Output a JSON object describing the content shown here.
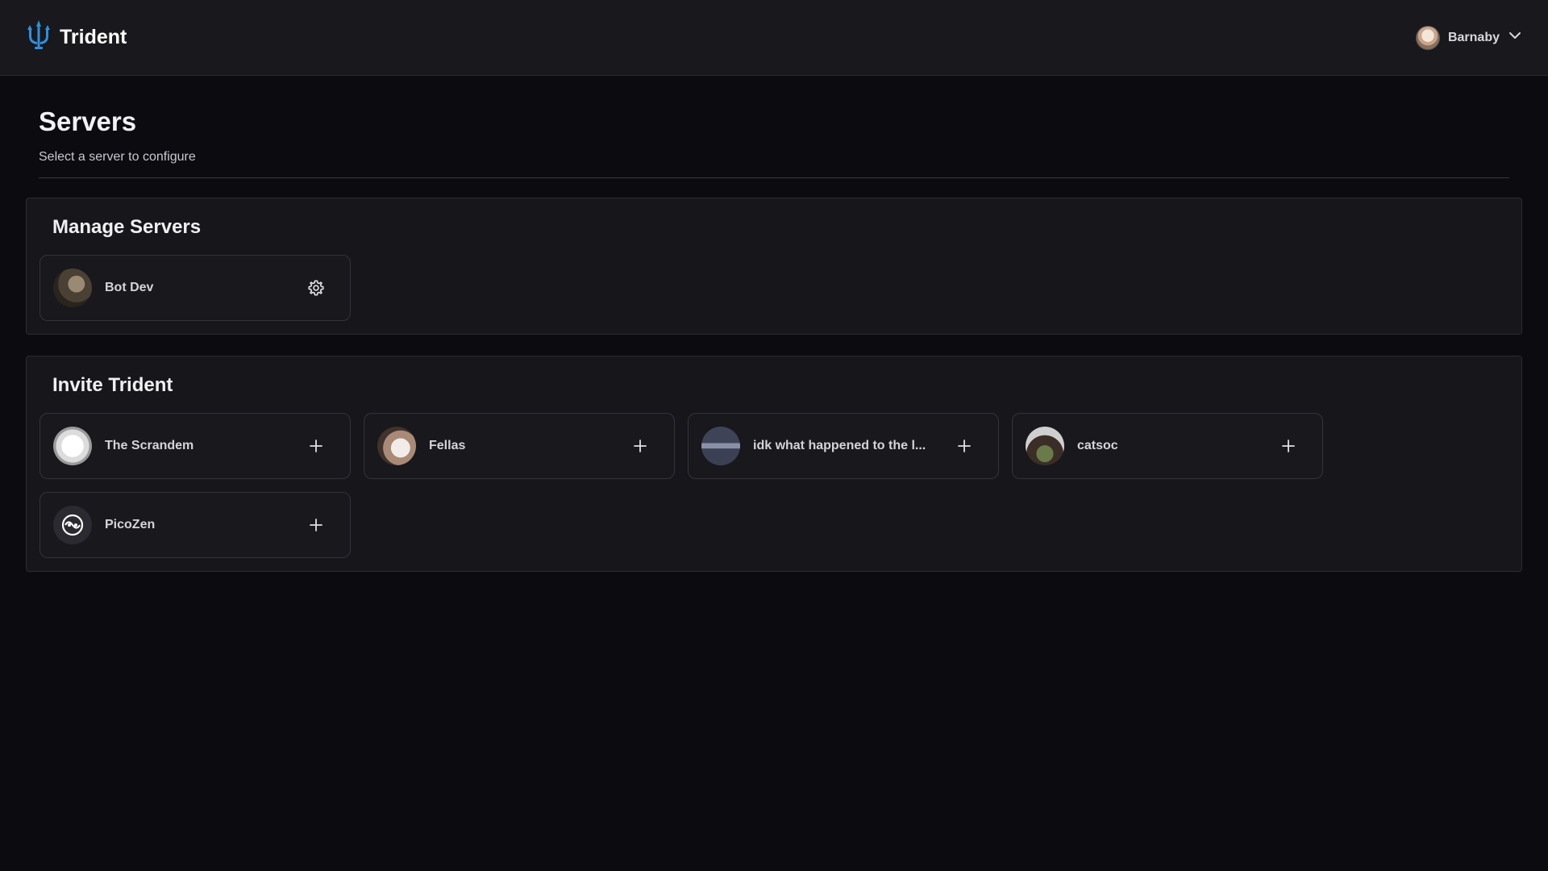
{
  "app": {
    "name": "Trident",
    "accent": "#2f8fe0"
  },
  "user": {
    "name": "Barnaby"
  },
  "page": {
    "title": "Servers",
    "subtitle": "Select a server to configure"
  },
  "manage": {
    "title": "Manage Servers",
    "servers": [
      {
        "name": "Bot Dev",
        "action_icon": "gear-icon"
      }
    ]
  },
  "invite": {
    "title": "Invite Trident",
    "servers": [
      {
        "name": "The Scrandem",
        "action_icon": "plus-icon"
      },
      {
        "name": "Fellas",
        "action_icon": "plus-icon"
      },
      {
        "name": "idk what happened to the l...",
        "action_icon": "plus-icon"
      },
      {
        "name": "catsoc",
        "action_icon": "plus-icon"
      },
      {
        "name": "PicoZen",
        "action_icon": "plus-icon"
      }
    ]
  }
}
